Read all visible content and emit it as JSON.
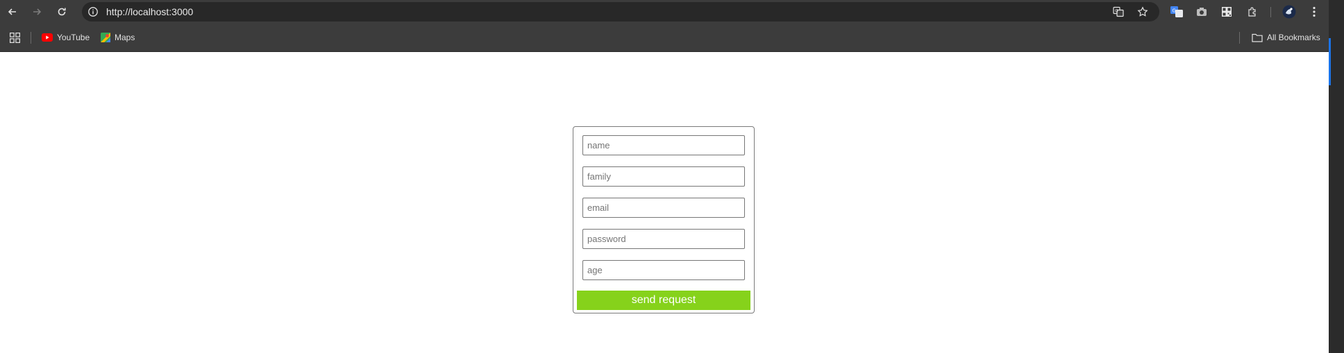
{
  "browser": {
    "url": "http://localhost:3000",
    "icons": {
      "back": "arrow-left-icon",
      "forward": "arrow-right-icon",
      "reload": "reload-icon",
      "site_info": "info-icon",
      "translate": "translate-icon",
      "bookmark_star": "star-icon",
      "extensions": [
        "google-translate-icon",
        "camera-icon",
        "qr-code-icon",
        "puzzle-icon"
      ],
      "profile": "avatar",
      "menu": "kebab-menu-icon"
    }
  },
  "bookmarks_bar": {
    "apps_icon": "apps-grid-icon",
    "items": [
      {
        "label": "YouTube",
        "icon": "youtube-icon"
      },
      {
        "label": "Maps",
        "icon": "maps-icon"
      }
    ],
    "all_bookmarks_label": "All Bookmarks",
    "all_bookmarks_icon": "folder-icon"
  },
  "form": {
    "fields": [
      {
        "placeholder": "name",
        "value": ""
      },
      {
        "placeholder": "family",
        "value": ""
      },
      {
        "placeholder": "email",
        "value": ""
      },
      {
        "placeholder": "password",
        "value": ""
      },
      {
        "placeholder": "age",
        "value": ""
      }
    ],
    "submit_label": "send request",
    "submit_color": "#86d21b"
  }
}
